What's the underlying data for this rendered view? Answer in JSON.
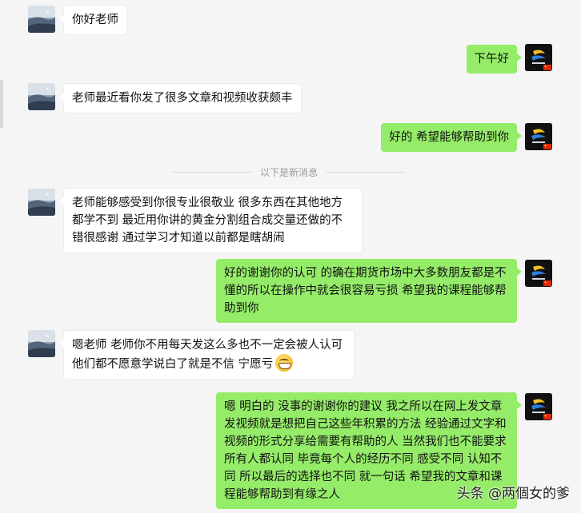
{
  "messages": [
    {
      "side": "left",
      "text": "你好老师"
    },
    {
      "side": "right",
      "text": "下午好"
    },
    {
      "side": "left",
      "text": "老师最近看你发了很多文章和视频收获颇丰"
    },
    {
      "side": "right",
      "text": "好的 希望能够帮助到你"
    },
    {
      "side": "left",
      "text": "老师能够感受到你很专业很敬业 很多东西在其他地方都学不到 最近用你讲的黄金分割组合成交量还做的不错很感谢 通过学习才知道以前都是瞎胡闹"
    },
    {
      "side": "right",
      "text": "好的谢谢你的认可 的确在期货市场中大多数朋友都是不懂的所以在操作中就会很容易亏损 希望我的课程能够帮助到你"
    },
    {
      "side": "left",
      "text": "嗯老师 老师你不用每天发这么多也不一定会被人认可 他们都不愿意学说白了就是不信 宁愿亏",
      "emoji": "grinning-face"
    },
    {
      "side": "right",
      "text": "嗯 明白的 没事的谢谢你的建议 我之所以在网上发文章 发视频就是想把自己这些年积累的方法 经验通过文字和视频的形式分享给需要有帮助的人 当然我们也不能要求所有人都认同 毕竟每个人的经历不同 感受不同 认知不同 所以最后的选择也不同 就一句话 希望我的文章和课程能够帮助到有缘之人"
    }
  ],
  "divider": {
    "text": "以下是新消息"
  },
  "watermark": {
    "text": "头条 @两個女的爹"
  },
  "colors": {
    "sent_bubble": "#95ec69",
    "received_bubble": "#ffffff",
    "background": "#f5f5f5"
  },
  "icons": {
    "left_avatar": "sky-landscape-avatar",
    "right_avatar": "brand-logo-avatar",
    "flag": "china-flag-icon"
  }
}
